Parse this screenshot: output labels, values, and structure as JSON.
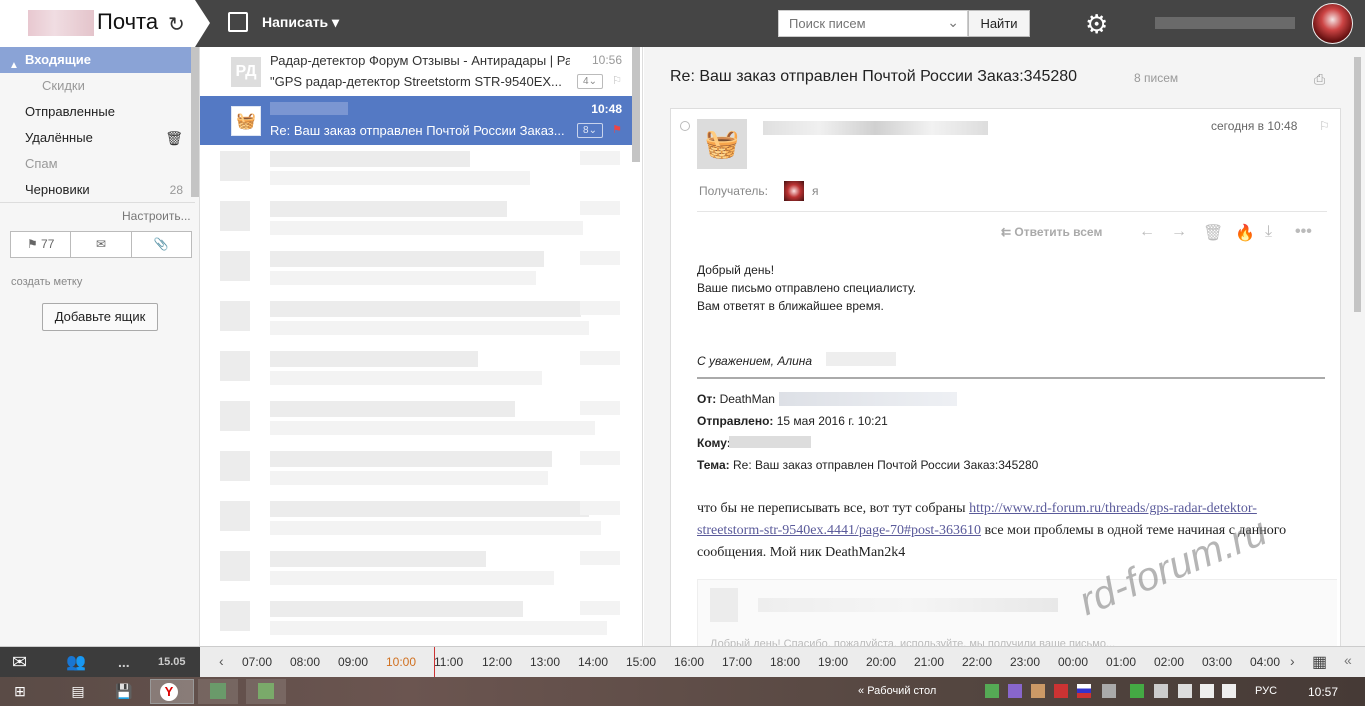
{
  "header": {
    "app_title": "Почта",
    "compose_label": "Написать",
    "search_placeholder": "Поиск писем",
    "search_button": "Найти"
  },
  "sidebar": {
    "folders": [
      {
        "label": "Входящие",
        "selected": true
      },
      {
        "label": "Скидки",
        "sub": true
      },
      {
        "label": "Отправленные"
      },
      {
        "label": "Удалённые"
      },
      {
        "label": "Спам",
        "dim": true
      },
      {
        "label": "Черновики",
        "count": "28"
      }
    ],
    "configure": "Настроить...",
    "flagged_count": "77",
    "create_label": "создать метку",
    "add_box": "Добавьте ящик"
  },
  "messages": [
    {
      "icon": "РД",
      "from": "Радар-детектор Форум Отзывы - Антирадары | Ра...",
      "subject": "\"GPS радар-детектор Streetstorm STR-9540EX...",
      "time": "10:56",
      "count": "4"
    },
    {
      "icon": "",
      "from": "",
      "subject": "Re: Ваш заказ отправлен Почтой России Заказ...",
      "time": "10:48",
      "count": "8",
      "selected": true
    }
  ],
  "reading": {
    "subject": "Re: Ваш заказ отправлен Почтой России Заказ:345280",
    "count": "8 писем",
    "time": "сегодня в 10:48",
    "recipient_label": "Получатель:",
    "recipient_name": "я",
    "reply_all": "Ответить всем",
    "greeting": "Добрый день!",
    "line2": "Ваше письмо отправлено специалисту.",
    "line3": "Вам ответят в ближайшее время.",
    "signature": "С уважением, Алина",
    "from_label": "От:",
    "from_value": "DeathMan",
    "sent_label": "Отправлено:",
    "sent_value": "15 мая 2016 г. 10:21",
    "to_label": "Кому:",
    "topic_label": "Тема:",
    "topic_value": "Re: Ваш заказ отправлен Почтой России Заказ:345280",
    "p_before": "что бы не переписывать все, вот тут собраны",
    "link": "http://www.rd-forum.ru/threads/gps-radar-detektor-streetstorm-str-9540ex.4441/page-70#post-363610",
    "p_after": "все мои проблемы в одной теме начиная с данного сообщения. Мой ник DeathMan2k4",
    "quote_text": "Добрый день! Спасибо, пожалуйста, используйте, мы получили ваше письмо..."
  },
  "watermark": "rd-forum.ru",
  "timeline": {
    "date": "15.05",
    "hours": [
      "07:00",
      "08:00",
      "09:00",
      "10:00",
      "11:00",
      "12:00",
      "13:00",
      "14:00",
      "15:00",
      "16:00",
      "17:00",
      "18:00",
      "19:00",
      "20:00",
      "21:00",
      "22:00",
      "23:00",
      "00:00",
      "01:00",
      "02:00",
      "03:00",
      "04:00"
    ]
  },
  "taskbar": {
    "desktop_label": "Рабочий стол",
    "lang": "РУС",
    "clock": "10:57"
  }
}
